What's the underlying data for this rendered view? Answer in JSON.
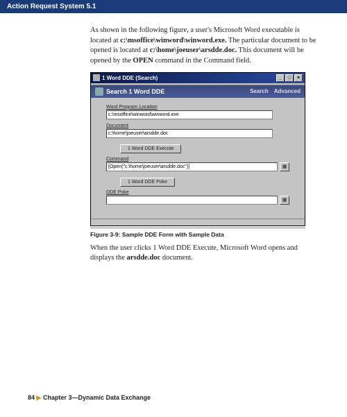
{
  "header": {
    "title": "Action Request System 5.1"
  },
  "intro": {
    "p1a": "As shown in the following figure, a user's Microsoft Word executable is located at ",
    "p1b": "c:\\msoffice\\winword\\winword.exe.",
    "p1c": " The particular document to be opened is located at ",
    "p1d": "c:\\home\\joeuser\\arsdde.doc.",
    "p1e": " This document will be opened by the ",
    "p1f": "OPEN",
    "p1g": " command in the Command field."
  },
  "window": {
    "title": "1 Word DDE (Search)",
    "min": "_",
    "max": "□",
    "close": "×",
    "toolbar": {
      "title": "Search 1 Word DDE",
      "search": "Search",
      "advanced": "Advanced"
    },
    "fields": {
      "prog_label": "Word Program Location",
      "prog_value": "c:\\msoffice\\winword\\winword.exe",
      "doc_label": "Document",
      "doc_value": "c:\\home\\joeuser\\arsdde.doc",
      "exec_btn": "1 Word DDE Execute",
      "cmd_label": "Command",
      "cmd_value": "[Open(\"c:\\home\\joeuser\\arsdde.doc\")]",
      "poke_btn": "1 Word DDE Poke",
      "poke_label": "DDE Poke",
      "poke_value": ""
    }
  },
  "caption": "Figure 3-9:  Sample DDE Form with Sample Data",
  "outro": {
    "a": "When the user clicks 1 Word DDE Execute, Microsoft Word opens and displays the ",
    "b": "arsdde.doc",
    "c": " document."
  },
  "footer": {
    "page": "84",
    "arrow": "▶",
    "chapter": "Chapter 3—Dynamic Data Exchange"
  }
}
